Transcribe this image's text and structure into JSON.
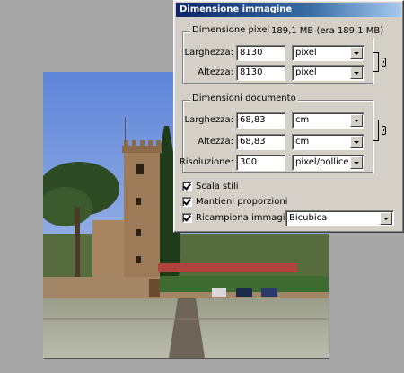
{
  "dialog": {
    "title": "Dimensione immagine",
    "pixel_group": {
      "label": "Dimensione pixel:",
      "size_text": "189,1 MB (era 189,1 MB)",
      "width_label": "Larghezza:",
      "width_value": "8130",
      "width_unit": "pixel",
      "height_label": "Altezza:",
      "height_value": "8130",
      "height_unit": "pixel"
    },
    "document_group": {
      "label": "Dimensioni documento",
      "width_label": "Larghezza:",
      "width_value": "68,83",
      "width_unit": "cm",
      "height_label": "Altezza:",
      "height_value": "68,83",
      "height_unit": "cm",
      "resolution_label": "Risoluzione:",
      "resolution_value": "300",
      "resolution_unit": "pixel/pollice"
    },
    "options": {
      "scale_styles": "Scala stili",
      "constrain_proportions": "Mantieni proporzioni",
      "resample": "Ricampiona immagine:",
      "resample_method": "Bicubica"
    }
  }
}
